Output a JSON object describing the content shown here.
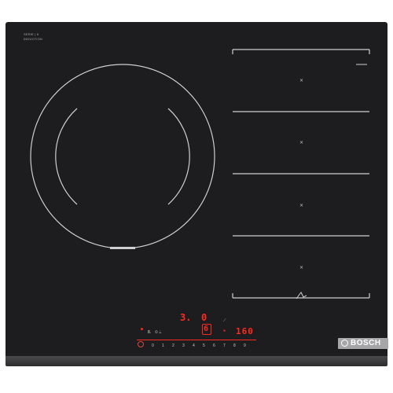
{
  "product": {
    "brand": "BOSCH",
    "series_label": "SERIE | 6",
    "feature_label": "INDUCTION"
  },
  "controls": {
    "zone_left_digit": "3.",
    "zone_right_digit": "0",
    "timer_display": "160",
    "selected_zone_value": "6",
    "left_indicator": "8.",
    "slider_numbers": [
      "0",
      "1",
      "2",
      "3",
      "4",
      "5",
      "6",
      "7",
      "8",
      "9"
    ]
  },
  "colors": {
    "glass": "#1d1d1f",
    "display_red": "#ff2a1e",
    "brand_plate": "#a6a6a8",
    "zone_lines": "#cfcfcf"
  },
  "icons": {
    "power": "power-icon",
    "flex_zone": "flex-zone-icon",
    "timer": "timer-icon"
  }
}
